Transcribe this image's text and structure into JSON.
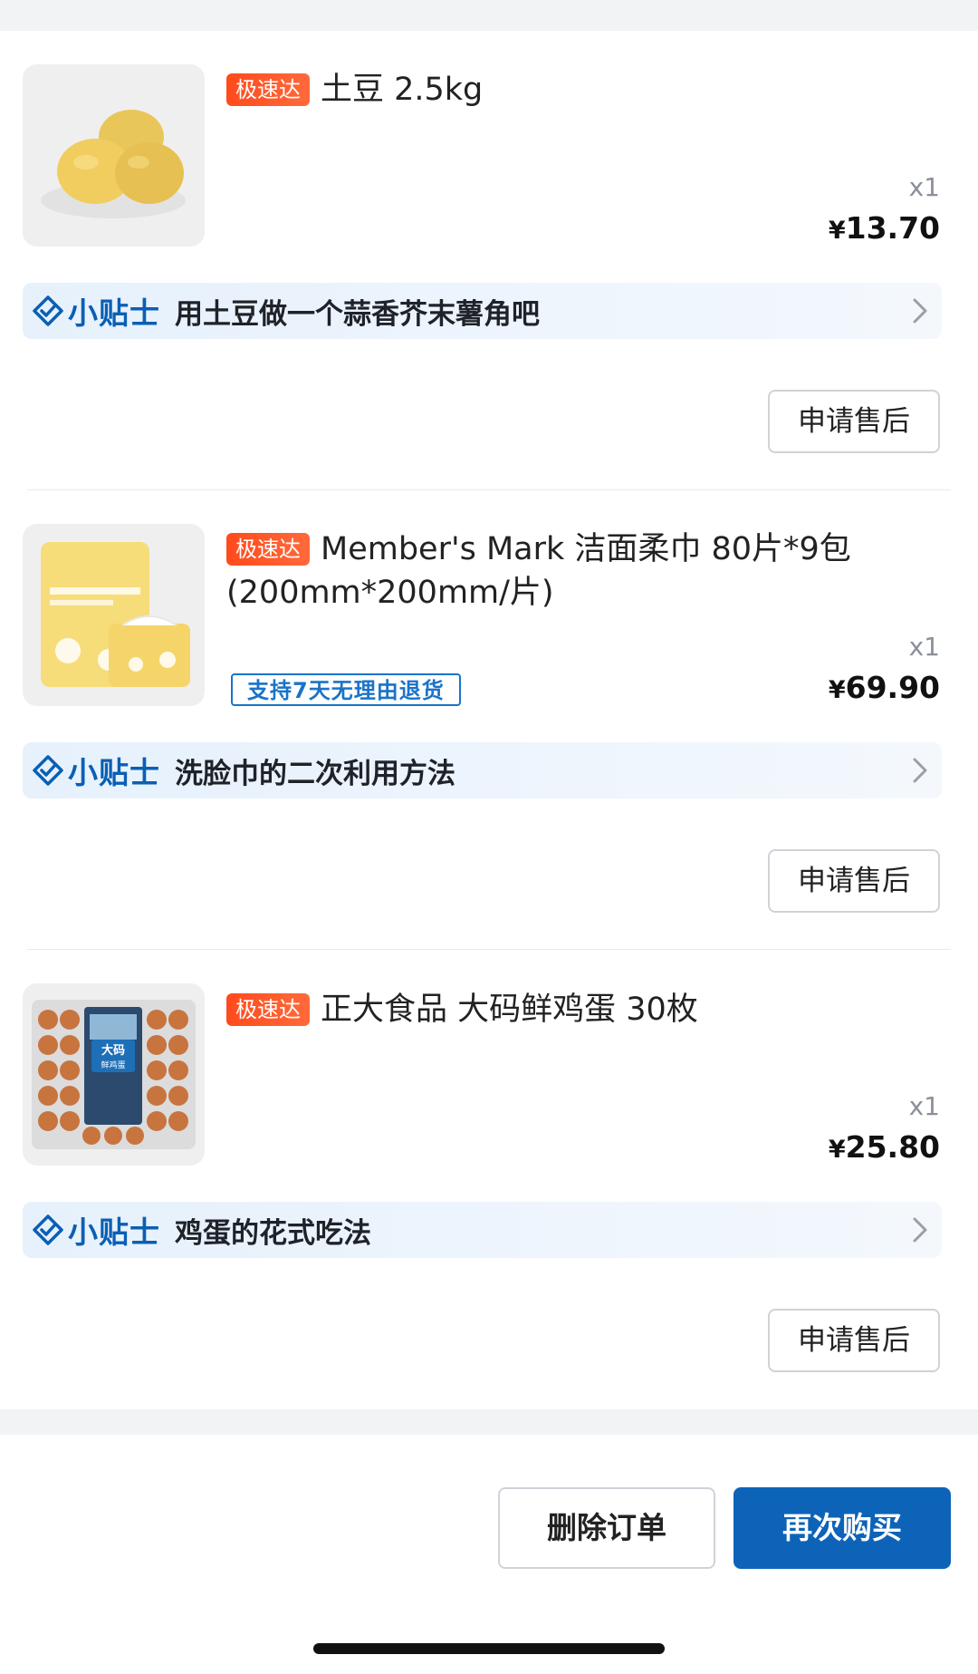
{
  "colors": {
    "brand_blue": "#0d63b8",
    "tag_orange": "#ff4a1c",
    "tip_background": "#e8f2fc",
    "page_gap": "#f2f3f5"
  },
  "items": [
    {
      "tag": "极速达",
      "title": "土豆 2.5kg",
      "quantity": "x1",
      "currency": "¥",
      "price": "13.70",
      "return_badge": "",
      "image_icon": "potato-image",
      "tip": {
        "brand": "小贴士",
        "text": "用土豆做一个蒜香芥末薯角吧",
        "icon": "diamond-check-icon"
      },
      "after_sale_label": "申请售后"
    },
    {
      "tag": "极速达",
      "title": "Member's Mark 洁面柔巾 80片*9包(200mm*200mm/片)",
      "quantity": "x1",
      "currency": "¥",
      "price": "69.90",
      "return_badge": "支持7天无理由退货",
      "image_icon": "face-towel-package-image",
      "tip": {
        "brand": "小贴士",
        "text": "洗脸巾的二次利用方法",
        "icon": "diamond-check-icon"
      },
      "after_sale_label": "申请售后"
    },
    {
      "tag": "极速达",
      "title": "正大食品 大码鲜鸡蛋 30枚",
      "quantity": "x1",
      "currency": "¥",
      "price": "25.80",
      "return_badge": "",
      "image_icon": "egg-tray-image",
      "image_label": "大码 鲜鸡蛋",
      "tip": {
        "brand": "小贴士",
        "text": "鸡蛋的花式吃法",
        "icon": "diamond-check-icon"
      },
      "after_sale_label": "申请售后"
    }
  ],
  "footer": {
    "delete_label": "删除订单",
    "rebuy_label": "再次购买"
  }
}
